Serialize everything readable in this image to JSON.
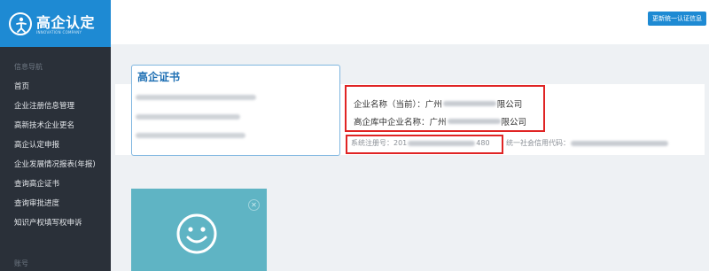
{
  "brand": {
    "title": "高企认定",
    "subtitle": "INNOVATION COMPANY"
  },
  "topbar": {
    "update_button": "更新统一认证信息"
  },
  "sidebar": {
    "section_label": "信息导航",
    "items": [
      {
        "label": "首页"
      },
      {
        "label": "企业注册信息管理"
      },
      {
        "label": "高新技术企业更名"
      },
      {
        "label": "高企认定申报"
      },
      {
        "label": "企业发展情况报表(年报)"
      },
      {
        "label": "查询高企证书"
      },
      {
        "label": "查询审批进度"
      },
      {
        "label": "知识产权填写权申诉"
      }
    ],
    "footer_label": "账号"
  },
  "certificate": {
    "title": "高企证书"
  },
  "company": {
    "current_name_label": "企业名称（当前）：",
    "current_name_prefix": "广州",
    "current_name_suffix": "限公司",
    "db_name_label": "高企库中企业名称：",
    "db_name_prefix": "广州",
    "db_name_suffix": "限公司",
    "reg_no_label": "系统注册号：",
    "reg_no_prefix": "201",
    "reg_no_suffix": "480",
    "credit_code_label": "统一社会信用代码："
  },
  "colors": {
    "accent": "#1e8ad3",
    "sidebar": "#2a3039",
    "highlight": "#e02424",
    "tile": "#5fb4c4"
  },
  "icons": {
    "logo": "person-logo-icon",
    "tile": "smiley-icon",
    "tile_close": "close-circle-icon"
  }
}
